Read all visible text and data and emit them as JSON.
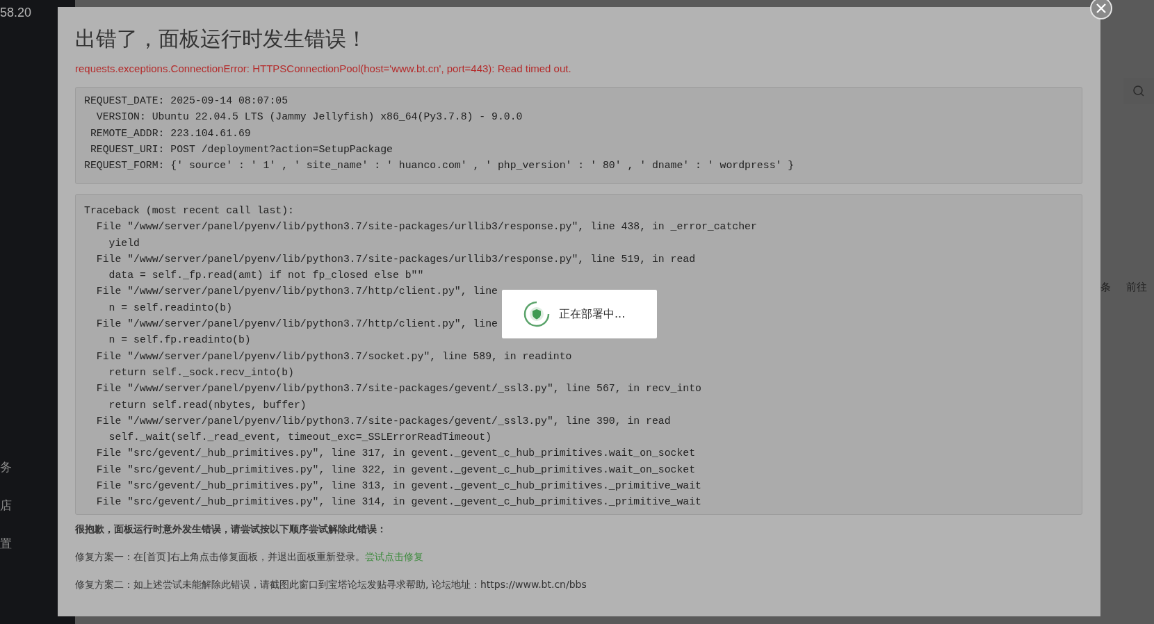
{
  "sidebar": {
    "header_fragment": "58.20",
    "item_fragments": [
      "务",
      "店",
      "置"
    ]
  },
  "background_page": {
    "pagination_fragments": [
      "条",
      "前往"
    ]
  },
  "dialog": {
    "title": "出错了，面板运行时发生错误！",
    "error_message": "requests.exceptions.ConnectionError: HTTPSConnectionPool(host='www.bt.cn', port=443): Read timed out.",
    "request_lines": [
      "REQUEST_DATE: 2025-09-14 08:07:05",
      "  VERSION: Ubuntu 22.04.5 LTS (Jammy Jellyfish) x86_64(Py3.7.8) - 9.0.0",
      " REMOTE_ADDR: 223.104.61.69",
      " REQUEST_URI: POST /deployment?action=SetupPackage",
      "REQUEST_FORM: {' source' : ' 1' , ' site_name' : ' huanco.com' , ' php_version' : ' 80' , ' dname' : ' wordpress' }"
    ],
    "traceback_lines": [
      "Traceback (most recent call last):",
      "  File \"/www/server/panel/pyenv/lib/python3.7/site-packages/urllib3/response.py\", line 438, in _error_catcher",
      "    yield",
      "  File \"/www/server/panel/pyenv/lib/python3.7/site-packages/urllib3/response.py\", line 519, in read",
      "    data = self._fp.read(amt) if not fp_closed else b\"\"",
      "  File \"/www/server/panel/pyenv/lib/python3.7/http/client.py\", line",
      "    n = self.readinto(b)",
      "  File \"/www/server/panel/pyenv/lib/python3.7/http/client.py\", line",
      "    n = self.fp.readinto(b)",
      "  File \"/www/server/panel/pyenv/lib/python3.7/socket.py\", line 589, in readinto",
      "    return self._sock.recv_into(b)",
      "  File \"/www/server/panel/pyenv/lib/python3.7/site-packages/gevent/_ssl3.py\", line 567, in recv_into",
      "    return self.read(nbytes, buffer)",
      "  File \"/www/server/panel/pyenv/lib/python3.7/site-packages/gevent/_ssl3.py\", line 390, in read",
      "    self._wait(self._read_event, timeout_exc=_SSLErrorReadTimeout)",
      "  File \"src/gevent/_hub_primitives.py\", line 317, in gevent._gevent_c_hub_primitives.wait_on_socket",
      "  File \"src/gevent/_hub_primitives.py\", line 322, in gevent._gevent_c_hub_primitives.wait_on_socket",
      "  File \"src/gevent/_hub_primitives.py\", line 313, in gevent._gevent_c_hub_primitives._primitive_wait",
      "  File \"src/gevent/_hub_primitives.py\", line 314, in gevent._gevent_c_hub_primitives._primitive_wait"
    ],
    "apology": "很抱歉，面板运行时意外发生错误，请尝试按以下顺序尝试解除此错误：",
    "fix_1": {
      "text": "修复方案一：在[首页]右上角点击修复面板，并退出面板重新登录。",
      "link": "尝试点击修复"
    },
    "fix_2": "修复方案二：如上述尝试未能解除此错误，请截图此窗口到宝塔论坛发贴寻求帮助, 论坛地址：https://www.bt.cn/bbs"
  },
  "loading_toast": {
    "message": "正在部署中..."
  }
}
